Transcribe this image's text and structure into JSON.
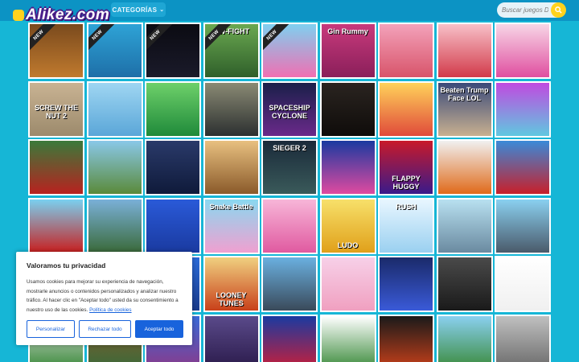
{
  "header": {
    "logo_text": "Alikez.com",
    "categories_label": "CATEGORÍAS",
    "search_placeholder": "Buscar juegos De"
  },
  "badges": {
    "new": "NEW"
  },
  "tiles": [
    {
      "name": "dungeon-doors",
      "bg": "linear-gradient(#7a4a1d,#c07a2e)",
      "new": true,
      "text": "",
      "textpos": ""
    },
    {
      "name": "ninja",
      "bg": "linear-gradient(#2ea3d6,#1e6fa8)",
      "new": true,
      "text": "",
      "textpos": ""
    },
    {
      "name": "neon-stick",
      "bg": "linear-gradient(#0b0b12,#1a1a2a)",
      "new": true,
      "text": "",
      "textpos": ""
    },
    {
      "name": "bow-fight",
      "bg": "linear-gradient(#6aa850,#2f5f2a)",
      "new": true,
      "text": "OW-FIGHT",
      "textpos": "top"
    },
    {
      "name": "stair-run",
      "bg": "linear-gradient(#7fd0f0,#f06fb2)",
      "new": true,
      "text": "",
      "textpos": ""
    },
    {
      "name": "gin-rummy",
      "bg": "linear-gradient(#c83a7c,#8a1f5a)",
      "new": false,
      "text": "Gin Rummy",
      "textpos": "top"
    },
    {
      "name": "furniture",
      "bg": "linear-gradient(#f3a2ba,#d8546a)",
      "new": false,
      "text": "",
      "textpos": ""
    },
    {
      "name": "princess-queen",
      "bg": "linear-gradient(#f7c0c8,#d23a4a)",
      "new": false,
      "text": "",
      "textpos": ""
    },
    {
      "name": "princess-dress",
      "bg": "linear-gradient(#f7d6e6,#e04fa0)",
      "new": false,
      "text": "",
      "textpos": ""
    },
    {
      "name": "screw-the-nut",
      "bg": "linear-gradient(#c9b393,#9c8a6c)",
      "new": false,
      "text": "SCREW THE NUT 2",
      "textpos": "mid"
    },
    {
      "name": "nail-salon",
      "bg": "linear-gradient(#9fd6f2,#5aa6d8)",
      "new": false,
      "text": "",
      "textpos": ""
    },
    {
      "name": "football-team",
      "bg": "linear-gradient(#6ed06a,#1f8a3a)",
      "new": false,
      "text": "",
      "textpos": ""
    },
    {
      "name": "dark-forest",
      "bg": "linear-gradient(#8a8a74,#2c3030)",
      "new": false,
      "text": "",
      "textpos": ""
    },
    {
      "name": "spaceship-cyclone",
      "bg": "linear-gradient(#1a1f4a,#6a2a8a)",
      "new": false,
      "text": "SPACESHIP CYCLONE",
      "textpos": "mid"
    },
    {
      "name": "horror-room",
      "bg": "linear-gradient(#2a2420,#0f0c0a)",
      "new": false,
      "text": "",
      "textpos": ""
    },
    {
      "name": "runner-3d",
      "bg": "linear-gradient(#ffd25a,#e04a3a)",
      "new": false,
      "text": "",
      "textpos": ""
    },
    {
      "name": "beaten-trump",
      "bg": "linear-gradient(#3a4a7a,#c8b090)",
      "new": false,
      "text": "Beaten Trump Face LOL",
      "textpos": "top"
    },
    {
      "name": "number-blocks",
      "bg": "linear-gradient(#c04ae0,#60c8e0)",
      "new": false,
      "text": "",
      "textpos": ""
    },
    {
      "name": "gingerbread",
      "bg": "linear-gradient(#3a7a3a,#b8221f)",
      "new": false,
      "text": "",
      "textpos": ""
    },
    {
      "name": "road-runner",
      "bg": "linear-gradient(#8ac8e8,#5a8a3a)",
      "new": false,
      "text": "",
      "textpos": ""
    },
    {
      "name": "escape-door",
      "bg": "linear-gradient(#2a3a6a,#0f1a3a)",
      "new": false,
      "text": "",
      "textpos": ""
    },
    {
      "name": "hidden-town",
      "bg": "linear-gradient(#e8c080,#8a5a2a)",
      "new": false,
      "text": "",
      "textpos": ""
    },
    {
      "name": "sieger-2",
      "bg": "linear-gradient(#1a2a3a,#3a5a5a)",
      "new": false,
      "text": "SIEGER 2",
      "textpos": "top"
    },
    {
      "name": "gem-blocks",
      "bg": "linear-gradient(#1a3aa0,#e04aa0)",
      "new": false,
      "text": "",
      "textpos": ""
    },
    {
      "name": "flappy-huggy",
      "bg": "linear-gradient(#c81a2a,#3a1a8a)",
      "new": false,
      "text": "FLAPPY HUGGY",
      "textpos": "bottom"
    },
    {
      "name": "dragon-fighter",
      "bg": "linear-gradient(#f0f0f0,#e06a1a)",
      "new": false,
      "text": "",
      "textpos": ""
    },
    {
      "name": "robot-mech",
      "bg": "linear-gradient(#3a8ad8,#c81f2a)",
      "new": false,
      "text": "",
      "textpos": ""
    },
    {
      "name": "truck-driver",
      "bg": "linear-gradient(#7ad0f0,#c81f1f)",
      "new": false,
      "text": "",
      "textpos": ""
    },
    {
      "name": "zombie-clown",
      "bg": "linear-gradient(#7ab0d8,#3a6a3a)",
      "new": false,
      "text": "",
      "textpos": ""
    },
    {
      "name": "connect-four",
      "bg": "linear-gradient(#2a5ad8,#1a3aa0)",
      "new": false,
      "text": "",
      "textpos": ""
    },
    {
      "name": "snake-battle",
      "bg": "linear-gradient(#8ad8f0,#f0a0d0)",
      "new": false,
      "text": "Snake Battle",
      "textpos": "top"
    },
    {
      "name": "pink-monster",
      "bg": "linear-gradient(#f7b6d8,#e05aa0)",
      "new": false,
      "text": "",
      "textpos": ""
    },
    {
      "name": "ludo",
      "bg": "linear-gradient(#f7e06a,#e0a01a)",
      "new": false,
      "text": "LUDO",
      "textpos": "bottom"
    },
    {
      "name": "rush-snow",
      "bg": "linear-gradient(#e8f6ff,#9ad0f0)",
      "new": false,
      "text": "RUSH",
      "textpos": "top"
    },
    {
      "name": "pipes",
      "bg": "linear-gradient(#b8e0f0,#6a8aa0)",
      "new": false,
      "text": "",
      "textpos": ""
    },
    {
      "name": "car-racing",
      "bg": "linear-gradient(#8ad0f0,#4a5a6a)",
      "new": false,
      "text": "",
      "textpos": ""
    },
    {
      "name": "hidden-row5a",
      "bg": "linear-gradient(#3a8a3a,#1a5a2a)",
      "new": false,
      "text": "",
      "textpos": ""
    },
    {
      "name": "hidden-row5b",
      "bg": "linear-gradient(#e0a05a,#8a5a2a)",
      "new": false,
      "text": "",
      "textpos": ""
    },
    {
      "name": "hidden-row5c",
      "bg": "linear-gradient(#2a6ad8,#1a3a8a)",
      "new": false,
      "text": "",
      "textpos": ""
    },
    {
      "name": "looney-tunes",
      "bg": "linear-gradient(#f0d080,#c8401a)",
      "new": false,
      "text": "LOONEY TUNES",
      "textpos": "bottom"
    },
    {
      "name": "cargo-truck",
      "bg": "linear-gradient(#6ab0e0,#3a4a5a)",
      "new": false,
      "text": "",
      "textpos": ""
    },
    {
      "name": "doll-dressup",
      "bg": "linear-gradient(#f7d0e8,#f0a0c0)",
      "new": false,
      "text": "",
      "textpos": ""
    },
    {
      "name": "space-rocket",
      "bg": "linear-gradient(#1a2a6a,#3a5ad8)",
      "new": false,
      "text": "",
      "textpos": ""
    },
    {
      "name": "soldier-mask",
      "bg": "linear-gradient(#4a4a4a,#1a1a1a)",
      "new": false,
      "text": "",
      "textpos": ""
    },
    {
      "name": "gun-shooter",
      "bg": "linear-gradient(#ffffff,#f0f0f0)",
      "new": false,
      "text": "",
      "textpos": ""
    },
    {
      "name": "hidden-row6a",
      "bg": "linear-gradient(#e0e0e0,#3a8a3a)",
      "new": false,
      "text": "",
      "textpos": ""
    },
    {
      "name": "hidden-row6b",
      "bg": "linear-gradient(#8a5a2a,#3a6a3a)",
      "new": false,
      "text": "",
      "textpos": ""
    },
    {
      "name": "hidden-items",
      "bg": "linear-gradient(#3a6ad8,#8a3a8a)",
      "new": false,
      "text": "",
      "textpos": ""
    },
    {
      "name": "zombie-night",
      "bg": "linear-gradient(#5a4a8a,#2a1a4a)",
      "new": false,
      "text": "",
      "textpos": ""
    },
    {
      "name": "huggy-duo",
      "bg": "linear-gradient(#1a3aa0,#c81f3a)",
      "new": false,
      "text": "",
      "textpos": ""
    },
    {
      "name": "pixel-jump",
      "bg": "linear-gradient(#ffffff,#3a8a3a)",
      "new": false,
      "text": "",
      "textpos": ""
    },
    {
      "name": "dark-dragon",
      "bg": "linear-gradient(#1a1a1a,#c8401a)",
      "new": false,
      "text": "",
      "textpos": ""
    },
    {
      "name": "block-world",
      "bg": "linear-gradient(#8ad0f0,#3a8a3a)",
      "new": false,
      "text": "",
      "textpos": ""
    },
    {
      "name": "car-parking",
      "bg": "linear-gradient(#c0c0c0,#6a6a6a)",
      "new": false,
      "text": "",
      "textpos": ""
    }
  ],
  "cookie": {
    "title": "Valoramos tu privacidad",
    "body": "Usamos cookies para mejorar su experiencia de navegación, mostrarle anuncios o contenidos personalizados y analizar nuestro tráfico. Al hacer clic en \"Aceptar todo\" usted da su consentimiento a nuestro uso de las cookies.",
    "policy_link": "Política de cookies",
    "customize": "Personalizar",
    "reject": "Rechazar todo",
    "accept": "Aceptar todo"
  }
}
